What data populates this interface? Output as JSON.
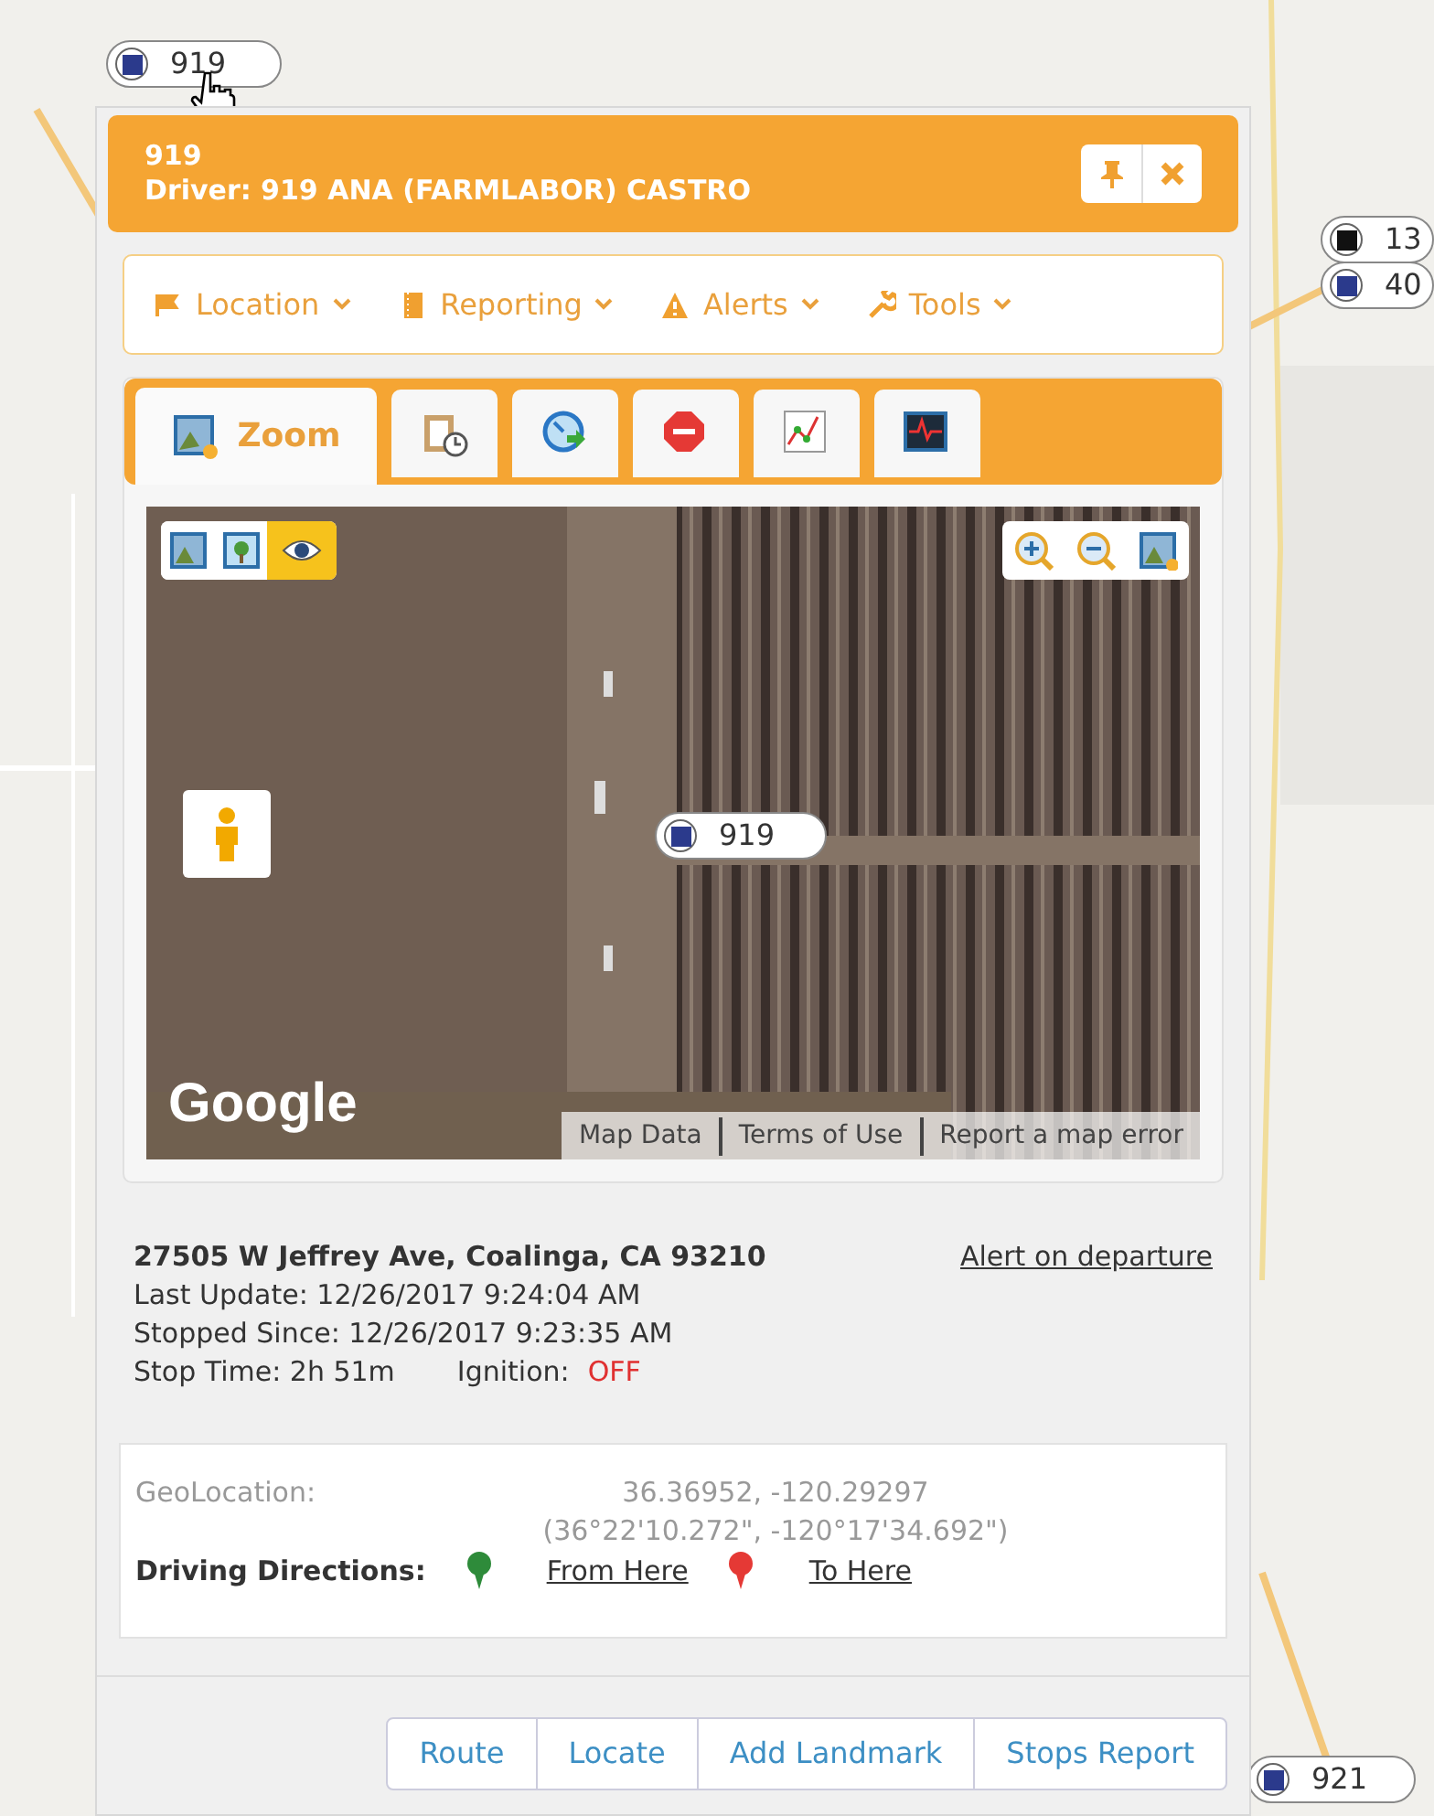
{
  "map_markers": [
    {
      "label": "919",
      "color": "#2b3a8c"
    },
    {
      "label": "13",
      "color": "#111111"
    },
    {
      "label": "40",
      "color": "#2b3a8c"
    },
    {
      "label": "921",
      "color": "#2b3a8c"
    }
  ],
  "popup": {
    "title": "919",
    "driver": "Driver: 919 ANA (FARMLABOR) CASTRO",
    "menu": [
      {
        "label": "Location"
      },
      {
        "label": "Reporting"
      },
      {
        "label": "Alerts"
      },
      {
        "label": "Tools"
      }
    ],
    "tabs": [
      {
        "label": "Zoom",
        "selected": true
      },
      {
        "selected": false
      },
      {
        "selected": false
      },
      {
        "selected": false
      },
      {
        "selected": false
      },
      {
        "selected": false
      }
    ],
    "map": {
      "modes": [
        {
          "selected": false
        },
        {
          "selected": false
        },
        {
          "selected": true
        }
      ],
      "marker": "919",
      "logo": "Google",
      "footer_links": [
        "Map Data",
        "Terms of Use",
        "Report a map error"
      ]
    },
    "address": "27505 W Jeffrey Ave, Coalinga, CA 93210",
    "alert_link": "Alert on departure",
    "last_update": "Last Update: 12/26/2017 9:24:04 AM",
    "stopped_since": "Stopped Since: 12/26/2017 9:23:35 AM",
    "stop_time": "Stop Time: 2h 51m",
    "ignition_label": "Ignition:",
    "ignition_value": "OFF",
    "ignition_on": false,
    "geo_label": "GeoLocation:",
    "geo_decimal": "36.36952, -120.29297",
    "geo_dms": "(36°22'10.272\", -120°17'34.692\")",
    "directions_label": "Driving Directions:",
    "from_here": "From Here",
    "to_here": "To Here",
    "buttons": [
      "Route",
      "Locate",
      "Add Landmark",
      "Stops Report"
    ]
  }
}
